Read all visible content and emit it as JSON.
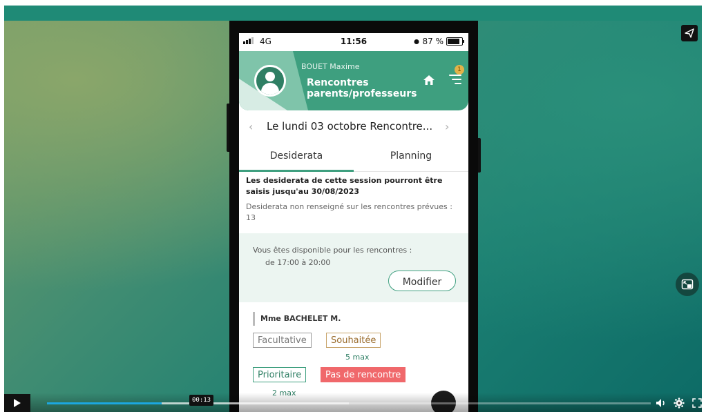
{
  "player": {
    "timecode": "00:13",
    "progress": 0.19,
    "buffered": 0.5
  },
  "phone": {
    "status": {
      "network": "4G",
      "time": "11:56",
      "battery": "87 %",
      "battery_level": 0.87
    },
    "header": {
      "user_name": "BOUET Maxime",
      "title": "Rencontres parents/professeurs",
      "badge_count": "1"
    },
    "session": {
      "title": "Le lundi 03 octobre Rencontre...",
      "prev_icon": "chevron-left-icon",
      "next_icon": "chevron-right-icon"
    },
    "tabs": [
      {
        "label": "Desiderata",
        "active": true
      },
      {
        "label": "Planning",
        "active": false
      }
    ],
    "notice": {
      "deadline": "Les desiderata de cette session pourront être saisis jusqu'au 30/08/2023",
      "missing": "Desiderata non renseigné sur les rencontres prévues : 13"
    },
    "availability": {
      "label": "Vous êtes disponible pour les rencontres :",
      "hours": "de 17:00 à 20:00",
      "edit_button": "Modifier"
    },
    "teacher": {
      "name": "Mme BACHELET M.",
      "options": {
        "facultative": "Facultative",
        "souhaitee": "Souhaitée",
        "souhaitee_max": "5 max",
        "prioritaire": "Prioritaire",
        "prioritaire_max": "2 max",
        "pas_de_rencontre": "Pas de rencontre"
      }
    }
  },
  "colors": {
    "brand_green": "#3e9f7f",
    "danger": "#f0686b",
    "progress": "#1ca7e0"
  }
}
